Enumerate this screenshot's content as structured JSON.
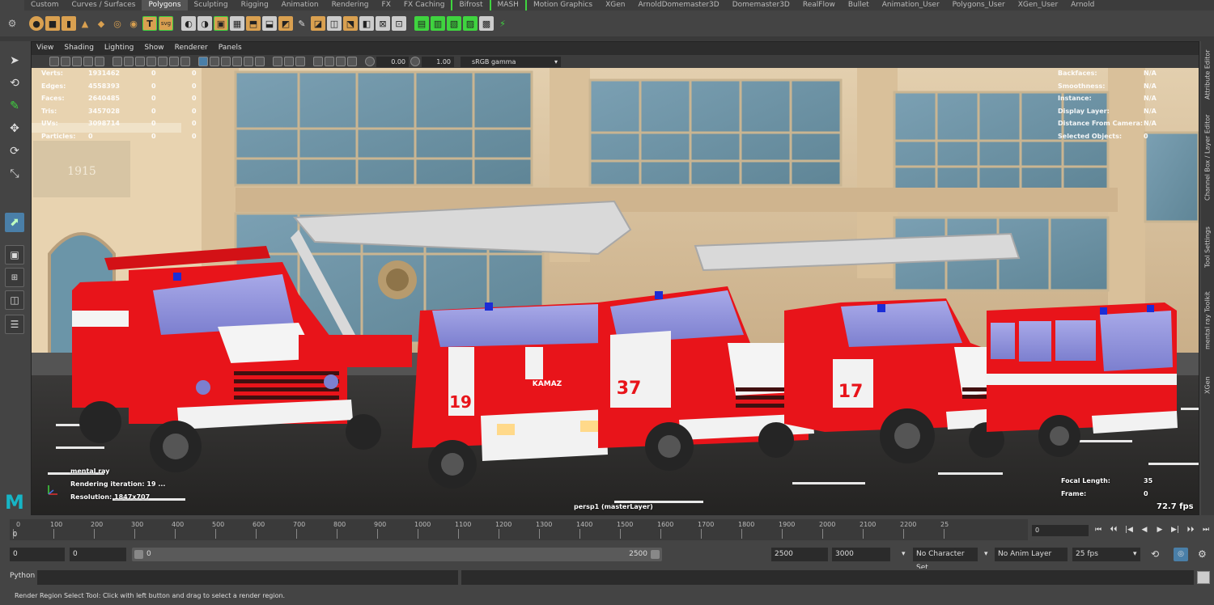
{
  "shelf_tabs": [
    "Custom",
    "Curves / Surfaces",
    "Polygons",
    "Sculpting",
    "Rigging",
    "Animation",
    "Rendering",
    "FX",
    "FX Caching",
    "Bifrost",
    "MASH",
    "Motion Graphics",
    "XGen",
    "ArnoldDomemaster3D",
    "Domemaster3D",
    "RealFlow",
    "Bullet",
    "Animation_User",
    "Polygons_User",
    "XGen_User",
    "Arnold"
  ],
  "active_shelf_tab": "Polygons",
  "panel_menu": [
    "View",
    "Shading",
    "Lighting",
    "Show",
    "Renderer",
    "Panels"
  ],
  "panel_toolbar": {
    "exposure": "0.00",
    "gamma": "1.00",
    "color_space": "sRGB gamma"
  },
  "hud": {
    "stats_labels": [
      "Verts:",
      "Edges:",
      "Faces:",
      "Tris:",
      "UVs:",
      "Particles:"
    ],
    "stats_values": [
      "1931462",
      "4558393",
      "2640485",
      "3457028",
      "3098714",
      "0"
    ],
    "stats_col2": [
      "0",
      "0",
      "0",
      "0",
      "0",
      "0"
    ],
    "stats_col3": [
      "0",
      "0",
      "0",
      "0",
      "0",
      "0"
    ],
    "right_labels": [
      "Backfaces:",
      "Smoothness:",
      "Instance:",
      "Display Layer:",
      "Distance From Camera:",
      "Selected Objects:"
    ],
    "right_values": [
      "N/A",
      "N/A",
      "N/A",
      "N/A",
      "N/A",
      "0"
    ],
    "renderer": "mental ray",
    "iteration": "Rendering iteration: 19 ...",
    "resolution": "Resolution: 1847x707",
    "camera": "persp1 (masterLayer)",
    "focal_label": "Focal Length:",
    "focal_value": "35",
    "frame_label": "Frame:",
    "frame_value": "0",
    "fps": "72.7 fps"
  },
  "scene": {
    "truck_numbers": [
      "19",
      "37",
      "17"
    ],
    "badge": "KAMAZ",
    "plaque": "1915"
  },
  "right_tabs": [
    "Attribute Editor",
    "Channel Box / Layer Editor",
    "Tool Settings",
    "mental ray Toolkit",
    "XGen"
  ],
  "timeline": {
    "ticks": [
      "0",
      "100",
      "200",
      "300",
      "400",
      "500",
      "600",
      "700",
      "800",
      "900",
      "1000",
      "1100",
      "1200",
      "1300",
      "1400",
      "1500",
      "1600",
      "1700",
      "1800",
      "1900",
      "2000",
      "2100",
      "2200",
      "25"
    ],
    "current_frame_marker": "0",
    "current_frame": "0",
    "playback_buttons": [
      "⏮",
      "⏴⏴",
      "|◀",
      "◀",
      "▶",
      "▶|",
      "⏵⏵",
      "⏭"
    ]
  },
  "range": {
    "start": "0",
    "playback_start": "0",
    "slider_start": "0",
    "slider_end": "2500",
    "playback_end": "2500",
    "end": "3000",
    "character_set": "No Character Set",
    "anim_layer": "No Anim Layer",
    "fps": "25 fps"
  },
  "command_line": {
    "language": "Python",
    "help": "Render Region Select Tool: Click with left button and drag to select a render region."
  },
  "logo": "M",
  "colors": {
    "truck_red": "#e8141a",
    "accent_green": "#3fd43f",
    "maya_teal": "#16b5c6"
  }
}
